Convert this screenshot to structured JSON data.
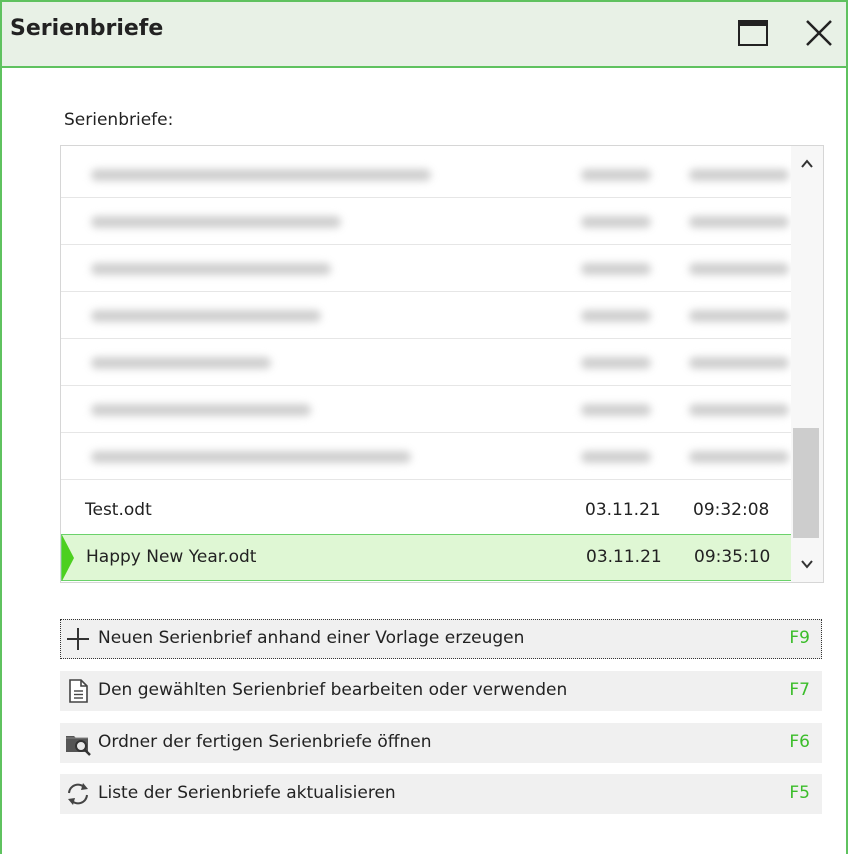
{
  "window": {
    "title": "Serienbriefe",
    "accent_color": "#5fc25f",
    "title_bar_color": "#e8f1e6",
    "selection_color": "#dff7d4",
    "marker_color": "#4cd01f",
    "shortcut_color": "#3bbd2a"
  },
  "list": {
    "label": "Serienbriefe:",
    "visible_items": [
      {
        "name": "Test.odt",
        "date": "03.11.21",
        "time": "09:32:08",
        "selected": false
      },
      {
        "name": "Happy New Year.odt",
        "date": "03.11.21",
        "time": "09:35:10",
        "selected": true
      }
    ],
    "blurred_rows_note_count": 7,
    "icons": {
      "scroll_up": "chevron-up-icon",
      "scroll_down": "chevron-down-icon"
    }
  },
  "actions": [
    {
      "icon": "plus-icon",
      "label": "Neuen Serienbrief anhand einer Vorlage erzeugen",
      "key": "F9"
    },
    {
      "icon": "document-icon",
      "label": "Den gewählten Serienbrief bearbeiten oder verwenden",
      "key": "F7"
    },
    {
      "icon": "folder-search-icon",
      "label": "Ordner der fertigen Serienbriefe öffnen",
      "key": "F6"
    },
    {
      "icon": "refresh-icon",
      "label": "Liste der Serienbriefe aktualisieren",
      "key": "F5"
    }
  ]
}
